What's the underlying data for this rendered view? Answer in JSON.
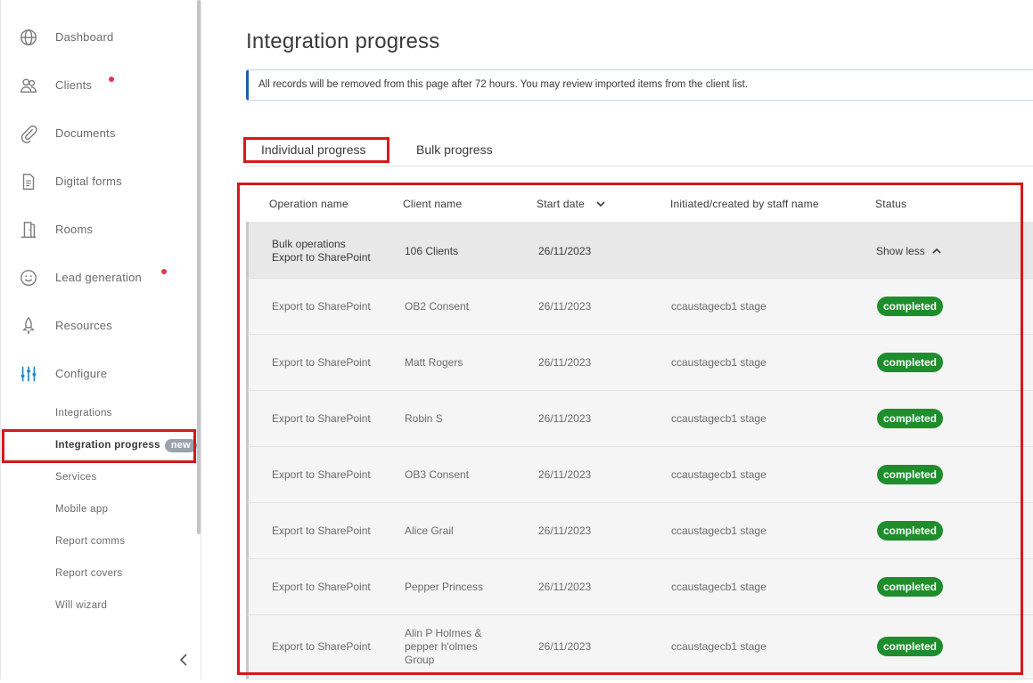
{
  "sidebar": {
    "items": [
      {
        "label": "Dashboard",
        "icon": "globe-icon"
      },
      {
        "label": "Clients",
        "icon": "users-icon",
        "dot": true
      },
      {
        "label": "Documents",
        "icon": "paperclip-icon"
      },
      {
        "label": "Digital forms",
        "icon": "document-icon"
      },
      {
        "label": "Rooms",
        "icon": "door-icon"
      },
      {
        "label": "Lead generation",
        "icon": "smiley-icon",
        "dot": true
      },
      {
        "label": "Resources",
        "icon": "rocket-icon"
      },
      {
        "label": "Configure",
        "icon": "sliders-icon"
      }
    ],
    "sub_items": [
      {
        "label": "Integrations"
      },
      {
        "label": "Integration progress",
        "badge": "new"
      },
      {
        "label": "Services"
      },
      {
        "label": "Mobile app"
      },
      {
        "label": "Report comms"
      },
      {
        "label": "Report covers"
      },
      {
        "label": "Will wizard"
      }
    ]
  },
  "page": {
    "title": "Integration progress",
    "banner": "All records will be removed from this page after 72 hours. You may review imported items from the client list."
  },
  "tabs": [
    {
      "label": "Individual progress",
      "active": true
    },
    {
      "label": "Bulk progress",
      "active": false
    }
  ],
  "table": {
    "headers": [
      "Operation name",
      "Client name",
      "Start date",
      "Initiated/created by staff name",
      "Status"
    ],
    "group": {
      "operation_line1": "Bulk operations",
      "operation_line2": "Export to SharePoint",
      "client": "106 Clients",
      "date": "26/11/2023",
      "status": "Show less"
    },
    "rows": [
      {
        "operation": "Export to SharePoint",
        "client": "OB2 Consent",
        "date": "26/11/2023",
        "staff": "ccaustagecb1 stage",
        "status": "completed"
      },
      {
        "operation": "Export to SharePoint",
        "client": "Matt Rogers",
        "date": "26/11/2023",
        "staff": "ccaustagecb1 stage",
        "status": "completed"
      },
      {
        "operation": "Export to SharePoint",
        "client": "Robin S",
        "date": "26/11/2023",
        "staff": "ccaustagecb1 stage",
        "status": "completed"
      },
      {
        "operation": "Export to SharePoint",
        "client": "OB3 Consent",
        "date": "26/11/2023",
        "staff": "ccaustagecb1 stage",
        "status": "completed"
      },
      {
        "operation": "Export to SharePoint",
        "client": "Alice Grail",
        "date": "26/11/2023",
        "staff": "ccaustagecb1 stage",
        "status": "completed"
      },
      {
        "operation": "Export to SharePoint",
        "client": "Pepper Princess",
        "date": "26/11/2023",
        "staff": "ccaustagecb1 stage",
        "status": "completed"
      },
      {
        "operation": "Export to SharePoint",
        "client": "Alin P Holmes & pepper h'olmes Group",
        "date": "26/11/2023",
        "staff": "ccaustagecb1 stage",
        "status": "completed"
      }
    ]
  },
  "colors": {
    "accent": "#1b5fb0",
    "success": "#1e8e2c",
    "highlight": "#d31a1a",
    "dot": "#e0384b"
  }
}
